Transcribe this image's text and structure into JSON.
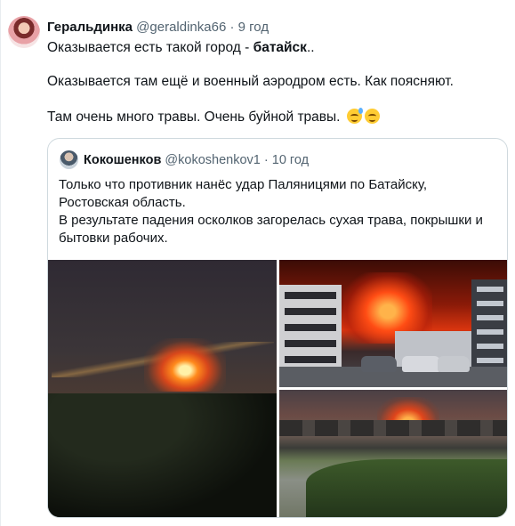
{
  "tweet": {
    "display_name": "Геральдинка",
    "handle": "@geraldinka66",
    "separator": "·",
    "time": "9 год",
    "line1_prefix": "Оказывается есть такой город - ",
    "line1_bold": "батайск",
    "line1_suffix": "..",
    "line2": "Оказывается там ещё и военный аэродром есть. Как поясняют.",
    "line3": "Там очень много травы. Очень буйной травы.",
    "emoji_names": [
      "sweat-smile-emoji",
      "relieved-emoji"
    ]
  },
  "quoted_tweet": {
    "display_name": "Кокошенков",
    "handle": "@kokoshenkov1",
    "separator": "·",
    "time": "10 год",
    "lines": [
      "Только что противник нанёс удар Паляницями по Батайску,",
      "Ростовская область.",
      "В результате падения осколков загорелась сухая трава, покрышки и",
      "бытовки рабочих."
    ],
    "photos": [
      {
        "name": "night-fire-over-trees-photo"
      },
      {
        "name": "fire-behind-apartment-buildings-photo"
      },
      {
        "name": "fire-over-houses-and-pond-photo"
      }
    ]
  }
}
